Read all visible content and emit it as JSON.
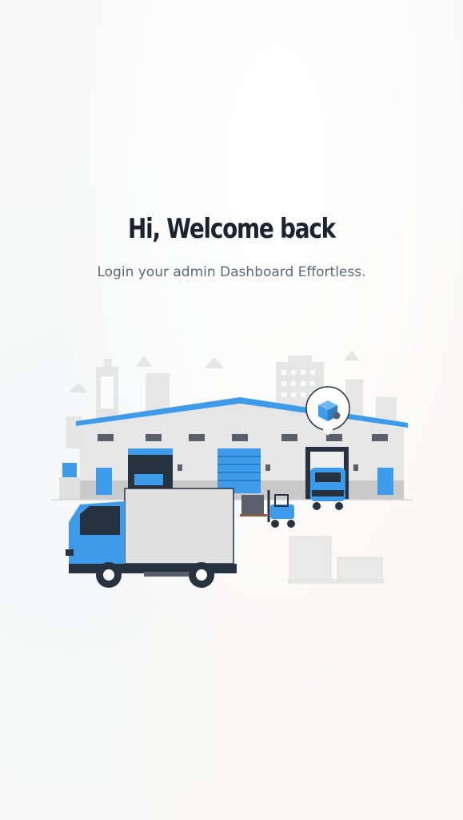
{
  "welcome": {
    "title": "Hi, Welcome back",
    "subtitle": "Login your admin Dashboard Effortless."
  },
  "illustration": {
    "name": "warehouse-delivery-illustration"
  },
  "colors": {
    "accent": "#3d9be9",
    "title": "#1c2330",
    "subtitle": "#5f6877",
    "background": "#f8f8f8"
  }
}
